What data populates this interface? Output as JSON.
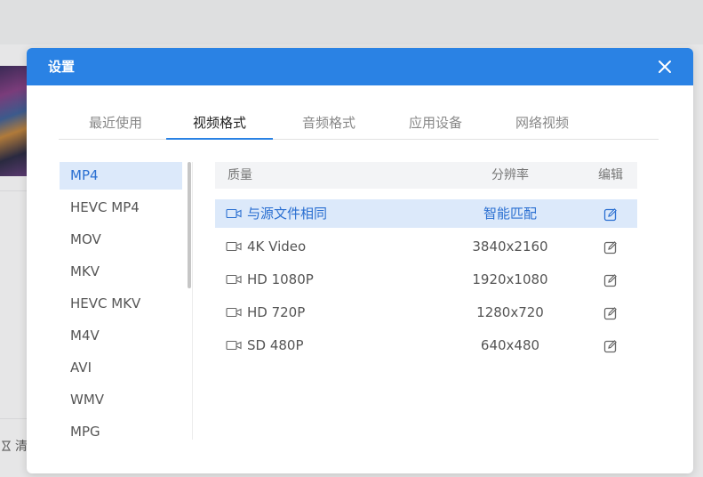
{
  "background": {
    "clear_label": "清"
  },
  "dialog": {
    "title": "设置",
    "close_icon": "close-icon"
  },
  "tabs": [
    {
      "label": "最近使用",
      "active": false
    },
    {
      "label": "视频格式",
      "active": true
    },
    {
      "label": "音频格式",
      "active": false
    },
    {
      "label": "应用设备",
      "active": false
    },
    {
      "label": "网络视频",
      "active": false
    }
  ],
  "formats": [
    "MP4",
    "HEVC MP4",
    "MOV",
    "MKV",
    "HEVC MKV",
    "M4V",
    "AVI",
    "WMV",
    "MPG"
  ],
  "selected_format": "MP4",
  "table": {
    "headers": {
      "quality": "质量",
      "resolution": "分辨率",
      "edit": "编辑"
    },
    "rows": [
      {
        "quality": "与源文件相同",
        "resolution": "智能匹配",
        "selected": true
      },
      {
        "quality": "4K Video",
        "resolution": "3840x2160",
        "selected": false
      },
      {
        "quality": "HD 1080P",
        "resolution": "1920x1080",
        "selected": false
      },
      {
        "quality": "HD 720P",
        "resolution": "1280x720",
        "selected": false
      },
      {
        "quality": "SD 480P",
        "resolution": "640x480",
        "selected": false
      }
    ]
  },
  "colors": {
    "accent": "#2a82e4",
    "selected_bg": "#dce9fa",
    "selected_text": "#2a6fd1"
  }
}
